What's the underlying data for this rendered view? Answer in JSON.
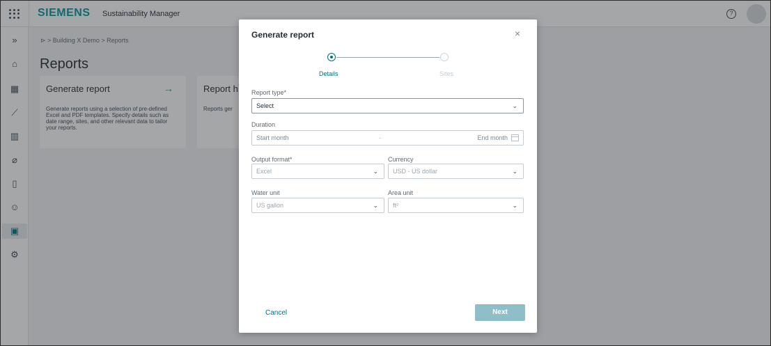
{
  "header": {
    "brand": "SIEMENS",
    "app_name": "Sustainability Manager",
    "help_symbol": "?"
  },
  "sidebar": {
    "items": [
      {
        "icon": "expand-icon",
        "glyph": "»"
      },
      {
        "icon": "home-icon",
        "glyph": "⌂"
      },
      {
        "icon": "building-icon",
        "glyph": "▦"
      },
      {
        "icon": "line-chart-icon",
        "glyph": "⟋"
      },
      {
        "icon": "bar-chart-icon",
        "glyph": "▥"
      },
      {
        "icon": "leaf-icon",
        "glyph": "⌀"
      },
      {
        "icon": "document-icon",
        "glyph": "▯"
      },
      {
        "icon": "people-icon",
        "glyph": "☺"
      },
      {
        "icon": "reports-icon",
        "glyph": "▣",
        "active": true
      },
      {
        "icon": "settings-icon",
        "glyph": "⚙"
      }
    ]
  },
  "breadcrumb": "⊳ > Building X Demo > Reports",
  "page_title": "Reports",
  "cards": [
    {
      "title": "Generate report",
      "arrow": "→",
      "description": "Generate reports using a selection of pre-defined Excel and PDF templates. Specify details such as date range, sites, and other relevant data to tailor your reports."
    },
    {
      "title": "Report h",
      "description": "Reports ger"
    }
  ],
  "modal": {
    "title": "Generate report",
    "close_symbol": "×",
    "steps": [
      {
        "label": "Details",
        "active": true
      },
      {
        "label": "Sites",
        "active": false
      }
    ],
    "fields": {
      "report_type": {
        "label": "Report type*",
        "value": "Select"
      },
      "duration": {
        "label": "Duration",
        "start_placeholder": "Start month",
        "separator": "-",
        "end_placeholder": "End month"
      },
      "output_format": {
        "label": "Output format*",
        "value": "Excel"
      },
      "currency": {
        "label": "Currency",
        "value": "USD - US dollar"
      },
      "water_unit": {
        "label": "Water unit",
        "value": "US gallon"
      },
      "area_unit": {
        "label": "Area unit",
        "value": "ft²"
      }
    },
    "chevron": "⌄",
    "cancel_label": "Cancel",
    "next_label": "Next"
  },
  "colors": {
    "brand": "#009999",
    "accent": "#00707e",
    "next_disabled": "#8ebfc9"
  }
}
